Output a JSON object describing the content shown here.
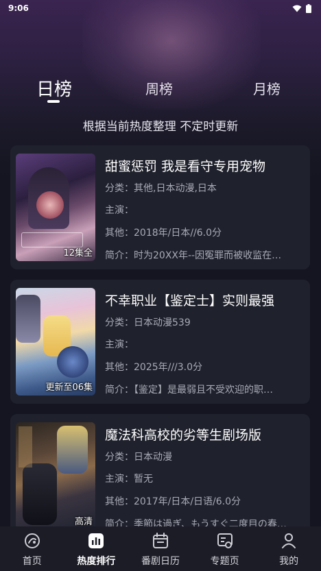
{
  "status_bar": {
    "time": "9:06"
  },
  "tabs": [
    {
      "label": "日榜",
      "active": true
    },
    {
      "label": "周榜",
      "active": false
    },
    {
      "label": "月榜",
      "active": false
    }
  ],
  "subtitle": "根据当前热度整理 不定时更新",
  "items": [
    {
      "title": "甜蜜惩罚 我是看守专用宠物",
      "category": "分类：其他,日本动漫,日本",
      "cast": "主演：",
      "other": "其他：2018年/日本//6.0分",
      "summary": "简介：时为20XX年--因冤罪而被收监在…",
      "badge": "12集全"
    },
    {
      "title": "不幸职业【鉴定士】实则最强",
      "category": "分类：日本动漫539",
      "cast": "主演：",
      "other": "其他：2025年///3.0分",
      "summary": "简介：【鉴定】是最弱且不受欢迎的职…",
      "badge": "更新至06集"
    },
    {
      "title": "魔法科高校的劣等生剧场版",
      "category": "分类：日本动漫",
      "cast": "主演：暂无",
      "other": "其他：2017年/日本/日语/6.0分",
      "summary": "简介：季節は過ぎ、もうすぐ二度目の春…",
      "badge": "高清"
    }
  ],
  "bottom_nav": [
    {
      "label": "首页",
      "icon": "home-icon",
      "active": false
    },
    {
      "label": "热度排行",
      "icon": "chart-icon",
      "active": true
    },
    {
      "label": "番剧日历",
      "icon": "calendar-icon",
      "active": false
    },
    {
      "label": "专题页",
      "icon": "topic-icon",
      "active": false
    },
    {
      "label": "我的",
      "icon": "profile-icon",
      "active": false
    }
  ]
}
